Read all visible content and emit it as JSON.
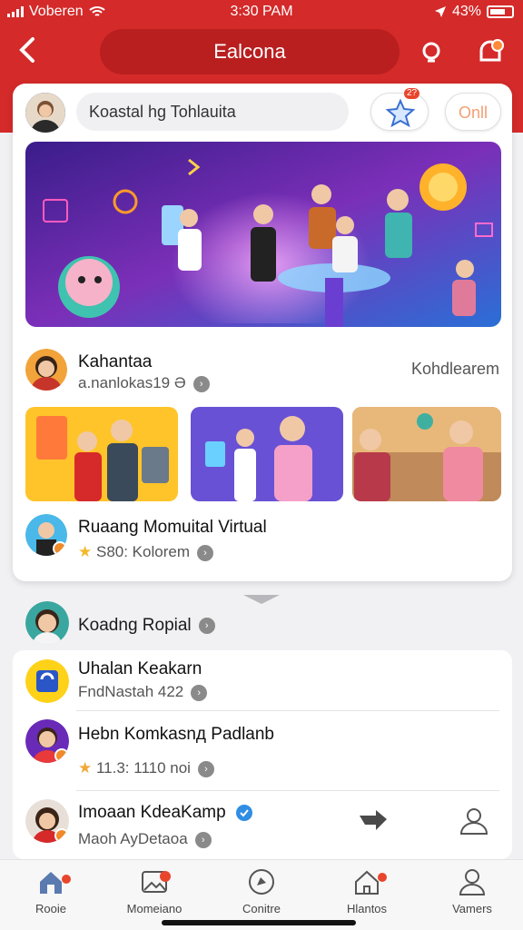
{
  "status_bar": {
    "carrier": "Voberen",
    "time": "3:30 PAM",
    "battery": "43%"
  },
  "header": {
    "title": "Ealcona",
    "search_icon": "search-icon",
    "notify_icon": "notification-icon"
  },
  "composer": {
    "search_value": "Koastal hg Tohlauita",
    "star_badge": "2?",
    "online_label": "Onll"
  },
  "feed": {
    "post_author": "Kahantaa",
    "post_meta": "a.nanlokas19 Ә",
    "follow_label": "Kohdlearem",
    "group_name": "Ruaang Momuital Virtual",
    "group_meta": "S80: Kolorem"
  },
  "list": {
    "section_title": "Koadng Ropial",
    "items": [
      {
        "name": "Uhalan Keakarn",
        "meta": "FndNastah 422"
      },
      {
        "name": "Hebn Komkasnд Padlanb",
        "meta": "11.3: 1110 noi"
      },
      {
        "name": "Imoaan KdeaKamp",
        "meta": "Maoh AyDetaoa"
      }
    ]
  },
  "nav": {
    "items": [
      {
        "label": "Rooie"
      },
      {
        "label": "Momeiano"
      },
      {
        "label": "Conitre"
      },
      {
        "label": "Hlantos"
      },
      {
        "label": "Vamers"
      }
    ]
  },
  "colors": {
    "accent": "#d42a2a",
    "badge": "#e8462c",
    "verified": "#2f8de4"
  }
}
